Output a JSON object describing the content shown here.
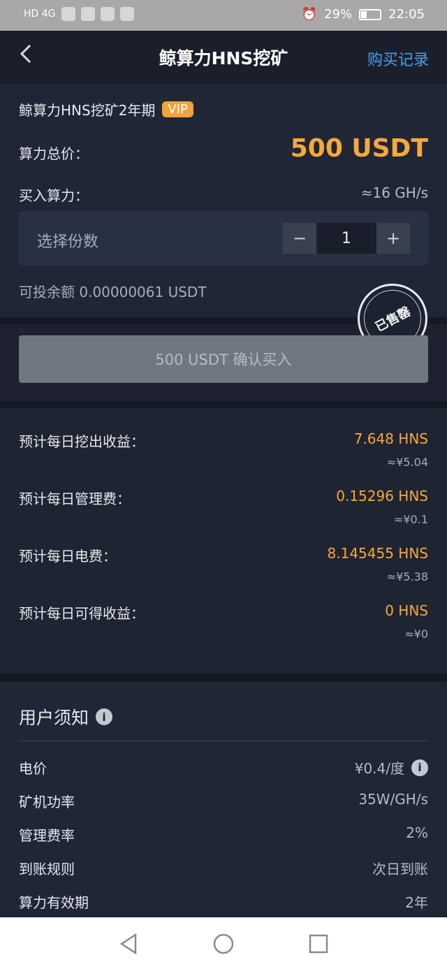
{
  "status_bar": {
    "left": "HD 4G",
    "right_pct": "29%",
    "time": "22:05"
  },
  "header": {
    "back_icon": "chevron-left-icon",
    "title": "鲸算力HNS挖矿",
    "records_label": "购买记录"
  },
  "product": {
    "plan_name": "鲸算力HNS挖矿2年期",
    "vip_badge": "VIP",
    "total_price_label": "算力总价：",
    "total_price": "500 USDT",
    "buy_hash_label": "买入算力：",
    "buy_hash": "≈16 GH/s",
    "qty_label": "选择份数",
    "qty_minus": "−",
    "qty_value": "1",
    "qty_plus": "+",
    "balance_text": "可投余额 0.00000061 USDT",
    "sold_out_stamp": "已售罄",
    "confirm_label": "500 USDT 确认买入"
  },
  "income": [
    {
      "label": "预计每日挖出收益：",
      "value": "7.648 HNS",
      "sub": "≈¥5.04"
    },
    {
      "label": "预计每日管理费：",
      "value": "0.15296 HNS",
      "sub": "≈¥0.1"
    },
    {
      "label": "预计每日电费：",
      "value": "8.145455 HNS",
      "sub": "≈¥5.38"
    },
    {
      "label": "预计每日可得收益：",
      "value": "0 HNS",
      "sub": "≈¥0"
    }
  ],
  "notice": {
    "title": "用户须知",
    "rows": [
      {
        "label": "电价",
        "value": "¥0.4/度"
      },
      {
        "label": "矿机功率",
        "value": "35W/GH/s"
      },
      {
        "label": "管理费率",
        "value": "2%"
      },
      {
        "label": "到账规则",
        "value": "次日到账"
      },
      {
        "label": "算力有效期",
        "value": "2年"
      }
    ]
  },
  "colors": {
    "accent_orange": "#f5a93a",
    "link_blue": "#4aa0ea",
    "bg": "#1e2230"
  }
}
